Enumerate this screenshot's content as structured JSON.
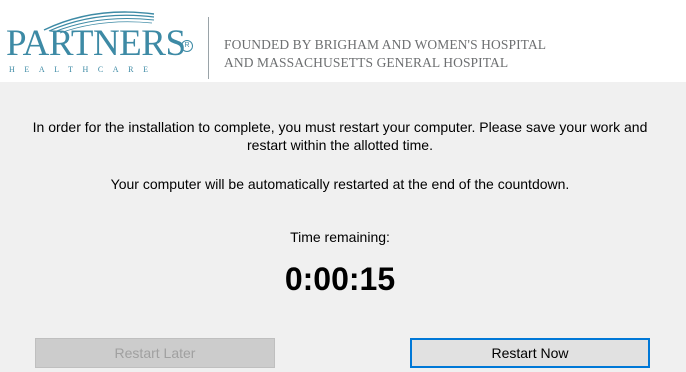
{
  "header": {
    "logo": {
      "wordmark": "PARTNERS",
      "registered": "R",
      "subtitle": "HEALTHCARE"
    },
    "tagline_line1": "FOUNDED BY BRIGHAM AND WOMEN'S HOSPITAL",
    "tagline_line2": "AND MASSACHUSETTS GENERAL HOSPITAL"
  },
  "dialog": {
    "message": "In order for the installation to complete, you must restart your computer. Please save your work and restart within the allotted time.",
    "auto_restart_notice": "Your computer will be automatically restarted at the end of the countdown.",
    "time_remaining_label": "Time remaining:",
    "countdown": "0:00:15",
    "restart_later_label": "Restart Later",
    "restart_now_label": "Restart Now"
  },
  "colors": {
    "brand": "#3d8aa5",
    "tagline": "#6d6f71",
    "dialog_background": "#f0f0f0",
    "focus_border": "#0078d7",
    "disabled_button": "#cccccc"
  },
  "states": {
    "restart_later_enabled": false,
    "restart_now_focused": true
  }
}
